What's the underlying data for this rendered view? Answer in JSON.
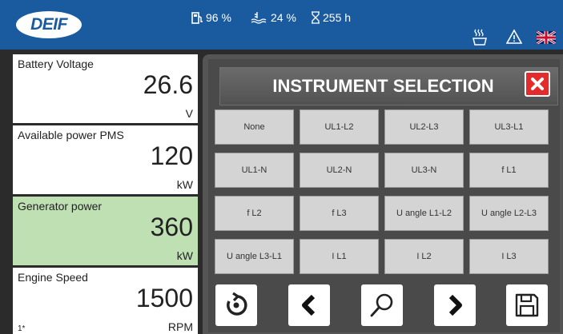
{
  "header": {
    "logo_text": "DEIF",
    "fuel_level": "96 %",
    "coolant_level": "24 %",
    "running_hours": "255 h",
    "icons": [
      "fuel-icon",
      "coolant-icon",
      "hourglass-icon",
      "heater-icon",
      "warning-icon",
      "uk-flag-icon"
    ],
    "brand_color": "#1a5ba0"
  },
  "panels": [
    {
      "title": "Battery Voltage",
      "value": "26.6",
      "unit": "V"
    },
    {
      "title": "Available power PMS",
      "value": "120",
      "unit": "kW"
    },
    {
      "title": "Generator power",
      "value": "360",
      "unit": "kW",
      "active": true,
      "color": "#bfe0b2"
    },
    {
      "title": "Engine Speed",
      "value": "1500",
      "unit": "RPM",
      "page": "1*"
    }
  ],
  "dialog": {
    "title": "INSTRUMENT SELECTION",
    "close_icon": "close-icon",
    "options": [
      "None",
      "UL1-L2",
      "UL2-L3",
      "UL3-L1",
      "UL1-N",
      "UL2-N",
      "UL3-N",
      "f L1",
      "f L2",
      "f L3",
      "U angle L1-L2",
      "U angle L2-L3",
      "U angle L3-L1",
      "I L1",
      "I L2",
      "I L3"
    ],
    "toolbar": [
      "refresh-icon",
      "chevron-left-icon",
      "search-icon",
      "chevron-right-icon",
      "save-icon"
    ]
  }
}
